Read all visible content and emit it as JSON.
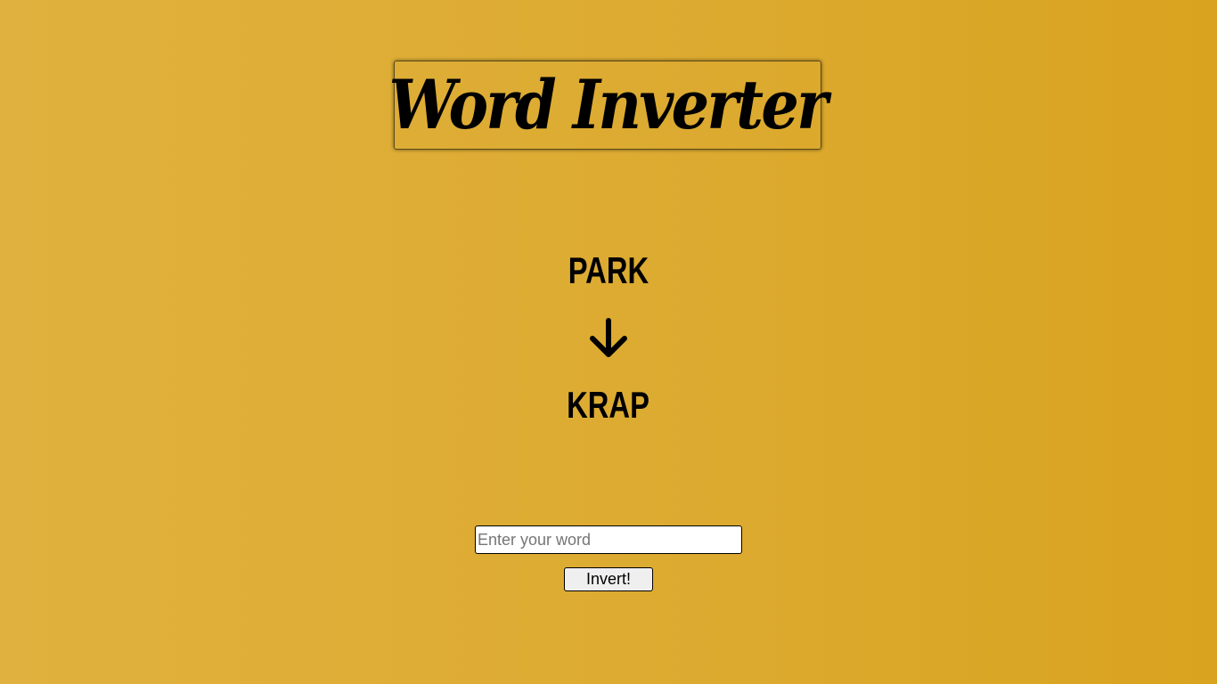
{
  "header": {
    "title": "Word Inverter"
  },
  "result": {
    "original_word": "PARK",
    "arrow_icon": "arrow-down-icon",
    "inverted_word": "KRAP"
  },
  "form": {
    "input_value": "",
    "input_placeholder": "Enter your word",
    "button_label": "Invert!"
  },
  "colors": {
    "background_left": "#e0b13e",
    "background_right": "#d9a31f",
    "text": "#000000"
  }
}
